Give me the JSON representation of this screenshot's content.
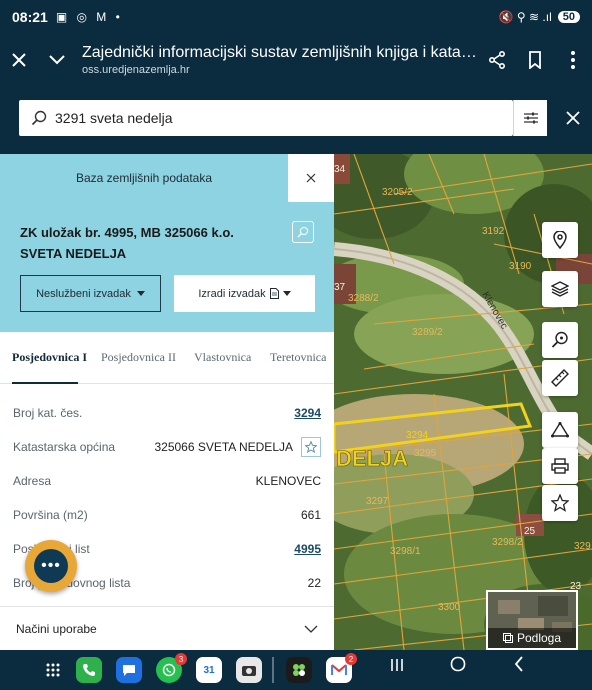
{
  "status": {
    "time": "08:21",
    "left_icons": "▣ ◎ M •",
    "right_icons": "🔇 ⚲ ≋ .ıl",
    "battery": "50"
  },
  "browser": {
    "title": "Zajednički informacijski sustav zemljišnih knjiga i katastra...",
    "url": "oss.uredjenazemlja.hr"
  },
  "search": {
    "value": "3291 sveta nedelja"
  },
  "panel": {
    "db_label": "Baza zemljišnih podataka",
    "zk_title": "ZK uložak br. 4995, MB 325066 k.o. SVETA NEDELJA",
    "unofficial_btn": "Neslužbeni izvadak",
    "create_btn": "Izradi izvadak",
    "tabs": [
      "Posjedovnica I",
      "Posjedovnica II",
      "Vlastovnica",
      "Teretovnica"
    ],
    "rows": [
      {
        "label": "Broj kat. čes.",
        "value": "3294"
      },
      {
        "label": "Katastarska općina",
        "value": "325066 SVETA NEDELJA"
      },
      {
        "label": "Adresa",
        "value": "KLENOVEC"
      },
      {
        "label": "Površina (m2)",
        "value": "661"
      },
      {
        "label": "Posjedovni list",
        "value": "4995"
      },
      {
        "label": "Broj posjedovnog lista",
        "value": "22"
      }
    ],
    "accordion": "Načini uporabe"
  },
  "map": {
    "labels": [
      "3205/2",
      "3192",
      "3190",
      "3288/2",
      "3289/2",
      "3294",
      "3295",
      "3297",
      "3298/2",
      "3298/1",
      "3300",
      "25",
      "23",
      "329",
      "34",
      "37"
    ],
    "street": "Klenovec",
    "big_label": "DELJA",
    "podloga": "Podloga"
  },
  "colors": {
    "header_bg": "#0b2b3e",
    "panel_head_bg": "#8dd3e2",
    "selection": "#f2d21a",
    "parcel_line": "#e0a53c"
  },
  "dock": {
    "badges": {
      "whatsapp": "3",
      "gmail": "2"
    },
    "calendar_day": "31"
  }
}
